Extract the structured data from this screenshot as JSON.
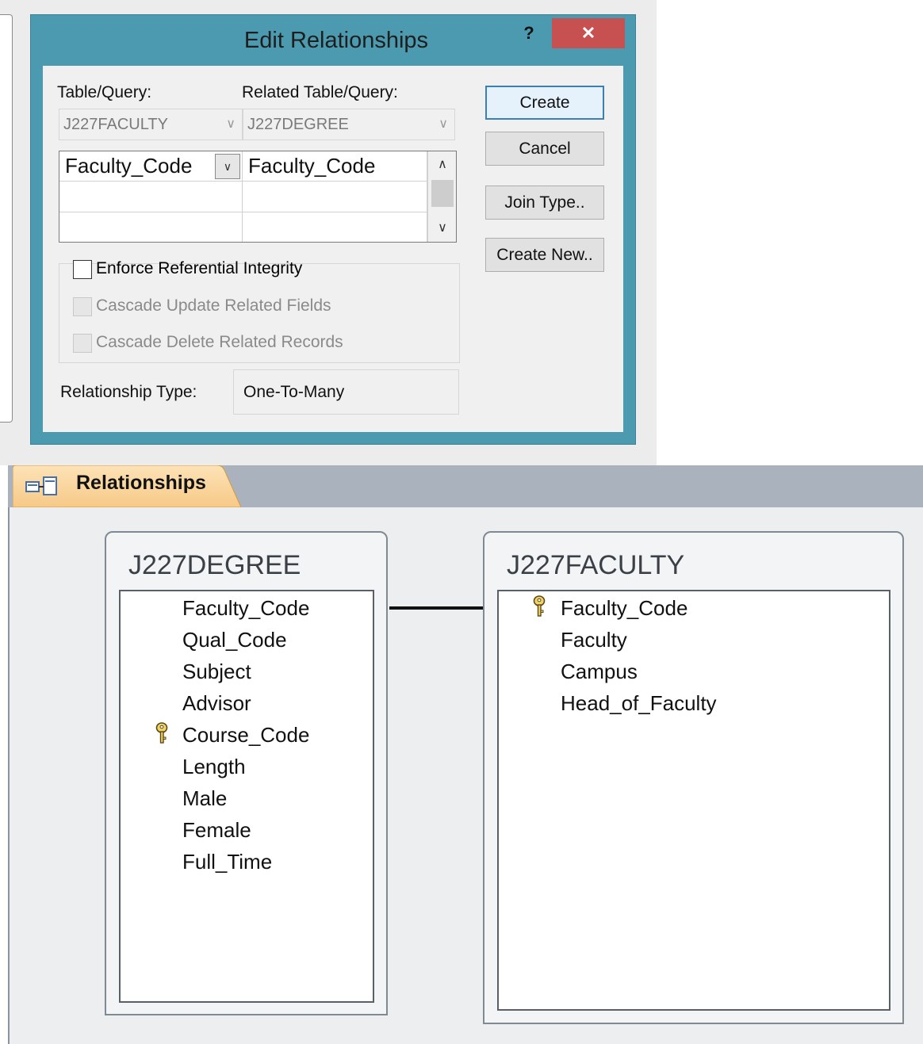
{
  "dialog": {
    "title": "Edit Relationships",
    "help_label": "?",
    "close_label": "✕",
    "table_query_label": "Table/Query:",
    "related_table_query_label": "Related Table/Query:",
    "table_query_value": "J227FACULTY",
    "related_table_query_value": "J227DEGREE",
    "field_rows": [
      {
        "left": "Faculty_Code",
        "right": "Faculty_Code"
      },
      {
        "left": "",
        "right": ""
      },
      {
        "left": "",
        "right": ""
      }
    ],
    "enforce_label": "Enforce Referential Integrity",
    "cascade_update_label": "Cascade Update Related Fields",
    "cascade_delete_label": "Cascade Delete Related Records",
    "relationship_type_label": "Relationship Type:",
    "relationship_type_value": "One-To-Many",
    "buttons": {
      "create": "Create",
      "cancel": "Cancel",
      "join_type": "Join Type..",
      "create_new": "Create New.."
    }
  },
  "relationships": {
    "tab_label": "Relationships",
    "tables": [
      {
        "title": "J227DEGREE",
        "fields": [
          {
            "name": "Faculty_Code",
            "key": false
          },
          {
            "name": "Qual_Code",
            "key": false
          },
          {
            "name": "Subject",
            "key": false
          },
          {
            "name": "Advisor",
            "key": false
          },
          {
            "name": "Course_Code",
            "key": true
          },
          {
            "name": "Length",
            "key": false
          },
          {
            "name": "Male",
            "key": false
          },
          {
            "name": "Female",
            "key": false
          },
          {
            "name": "Full_Time",
            "key": false
          }
        ]
      },
      {
        "title": "J227FACULTY",
        "fields": [
          {
            "name": "Faculty_Code",
            "key": true
          },
          {
            "name": "Faculty",
            "key": false
          },
          {
            "name": "Campus",
            "key": false
          },
          {
            "name": "Head_of_Faculty",
            "key": false
          }
        ]
      }
    ]
  },
  "colors": {
    "dialog_frame": "#4c9ab0",
    "close_button": "#c75050",
    "tab_accent": "#f5c483",
    "default_button_border": "#3c7fb1"
  }
}
